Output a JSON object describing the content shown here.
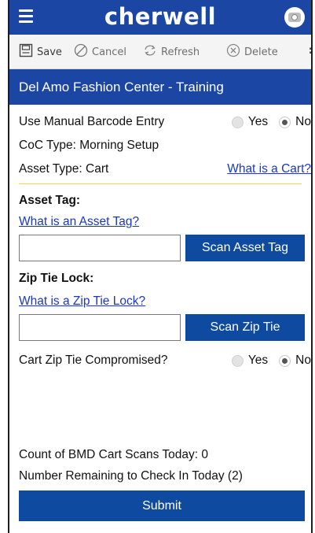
{
  "header": {
    "brand": "cherwell"
  },
  "toolbar": {
    "save_label": "Save",
    "cancel_label": "Cancel",
    "refresh_label": "Refresh",
    "delete_label": "Delete",
    "more_label": ":"
  },
  "form_title": "Del Amo Fashion Center - Training",
  "fields": {
    "manual_barcode_label": "Use Manual Barcode Entry",
    "manual_barcode_yes": "Yes",
    "manual_barcode_no": "No",
    "manual_barcode_selected": "No",
    "coc_type": "CoC Type: Morning Setup",
    "asset_type": "Asset Type: Cart",
    "what_is_cart": "What is a Cart?",
    "asset_tag_label": "Asset Tag:",
    "what_is_asset_tag": "What is an Asset Tag?",
    "asset_tag_value": "",
    "scan_asset_tag": "Scan Asset Tag",
    "zip_tie_label": "Zip Tie Lock:",
    "what_is_zip_tie": "What is a Zip Tie Lock?",
    "zip_tie_value": "",
    "scan_zip_tie": "Scan Zip Tie",
    "compromised_label": "Cart Zip Tie Compromised?",
    "compromised_yes": "Yes",
    "compromised_no": "No",
    "compromised_selected": "No",
    "scan_count": "Count of BMD Cart Scans Today: 0",
    "remaining": "Number Remaining to Check In Today (2)"
  },
  "submit_label": "Submit",
  "colors": {
    "brand_blue": "#1c46a3",
    "button_blue": "#0e4aa0",
    "link": "#1a36c9",
    "divider": "#f1d24a"
  },
  "icons": [
    "menu-icon",
    "camera-icon",
    "save-icon",
    "cancel-icon",
    "refresh-icon",
    "delete-icon",
    "more-icon"
  ]
}
